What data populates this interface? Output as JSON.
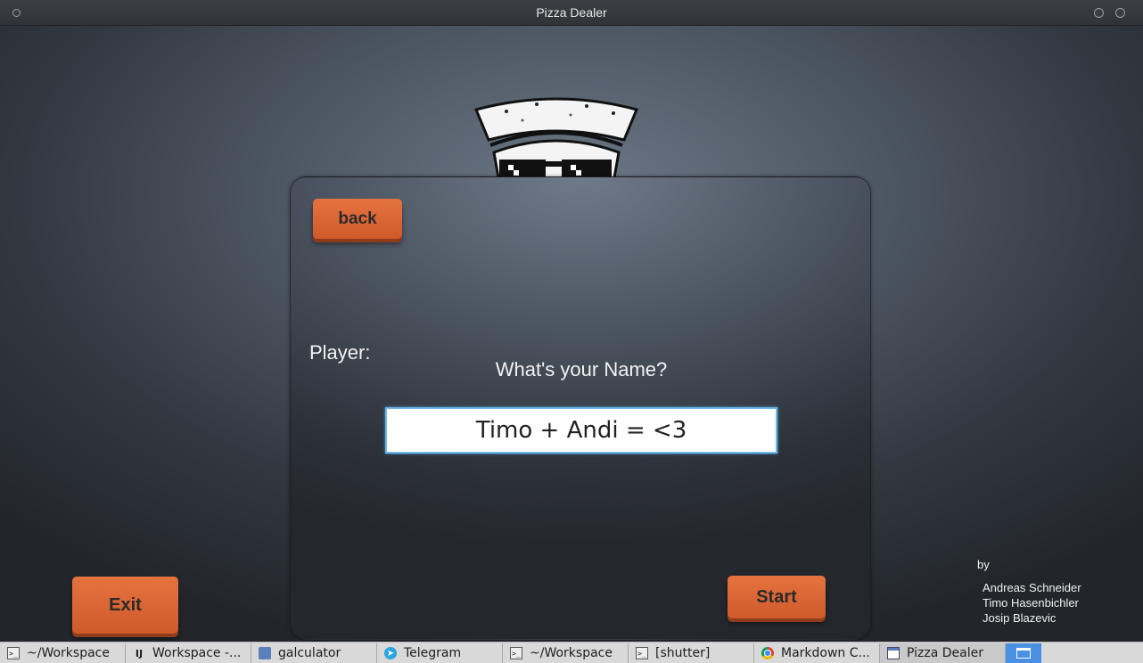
{
  "window": {
    "title": "Pizza Dealer"
  },
  "panel": {
    "back_label": "back",
    "player_label": "Player:",
    "prompt": "What's your Name?",
    "name_value": "Timo + Andi = <3",
    "start_label": "Start"
  },
  "exit_label": "Exit",
  "credits": {
    "by": "by",
    "authors": [
      "Andreas Schneider",
      "Timo Hasenbichler",
      "Josip Blazevic"
    ]
  },
  "colors": {
    "accent": "#dd6a36",
    "input_focus": "#6fb7e8"
  },
  "taskbar": {
    "items": [
      {
        "label": "~/Workspace",
        "icon": "terminal-icon"
      },
      {
        "label": "Workspace -...",
        "icon": "intellij-icon"
      },
      {
        "label": "galculator",
        "icon": "calculator-icon"
      },
      {
        "label": "Telegram",
        "icon": "telegram-icon"
      },
      {
        "label": "~/Workspace",
        "icon": "terminal-icon"
      },
      {
        "label": "[shutter]",
        "icon": "terminal-icon"
      },
      {
        "label": "Markdown C...",
        "icon": "chrome-icon"
      },
      {
        "label": "Pizza Dealer",
        "icon": "window-icon"
      }
    ]
  }
}
